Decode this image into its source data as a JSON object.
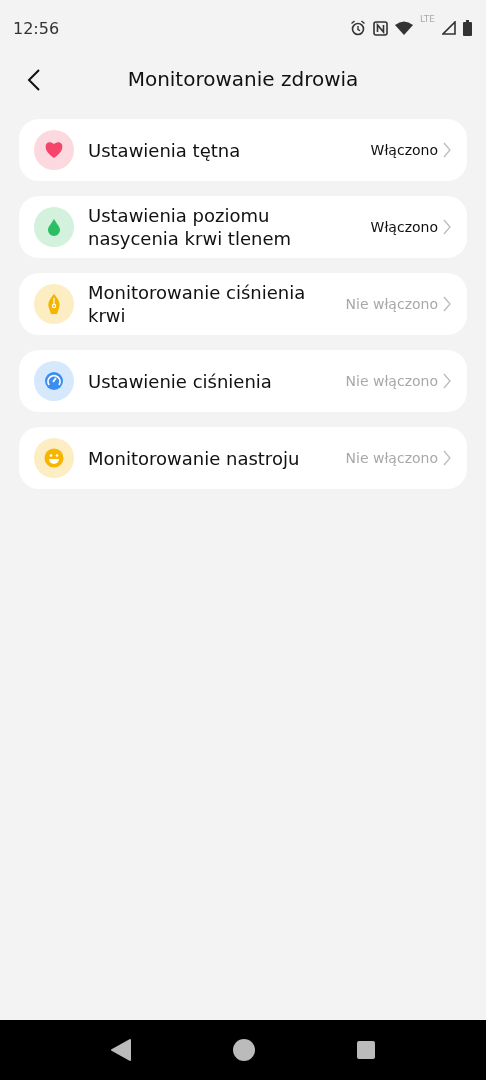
{
  "status_bar": {
    "time": "12:56",
    "network": "LTE"
  },
  "header": {
    "title": "Monitorowanie zdrowia"
  },
  "items": [
    {
      "kind": "heart",
      "label": "Ustawienia tętna",
      "status": "Włączono",
      "enabled": true
    },
    {
      "kind": "drop",
      "label": "Ustawienia poziomu nasycenia krwi tlenem",
      "status": "Włączono",
      "enabled": true
    },
    {
      "kind": "pen",
      "label": "Monitorowanie ciśnienia krwi",
      "status": "Nie włączono",
      "enabled": false
    },
    {
      "kind": "gauge",
      "label": "Ustawienie ciśnienia",
      "status": "Nie włączono",
      "enabled": false
    },
    {
      "kind": "smile",
      "label": "Monitorowanie nastroju",
      "status": "Nie włączono",
      "enabled": false
    }
  ]
}
